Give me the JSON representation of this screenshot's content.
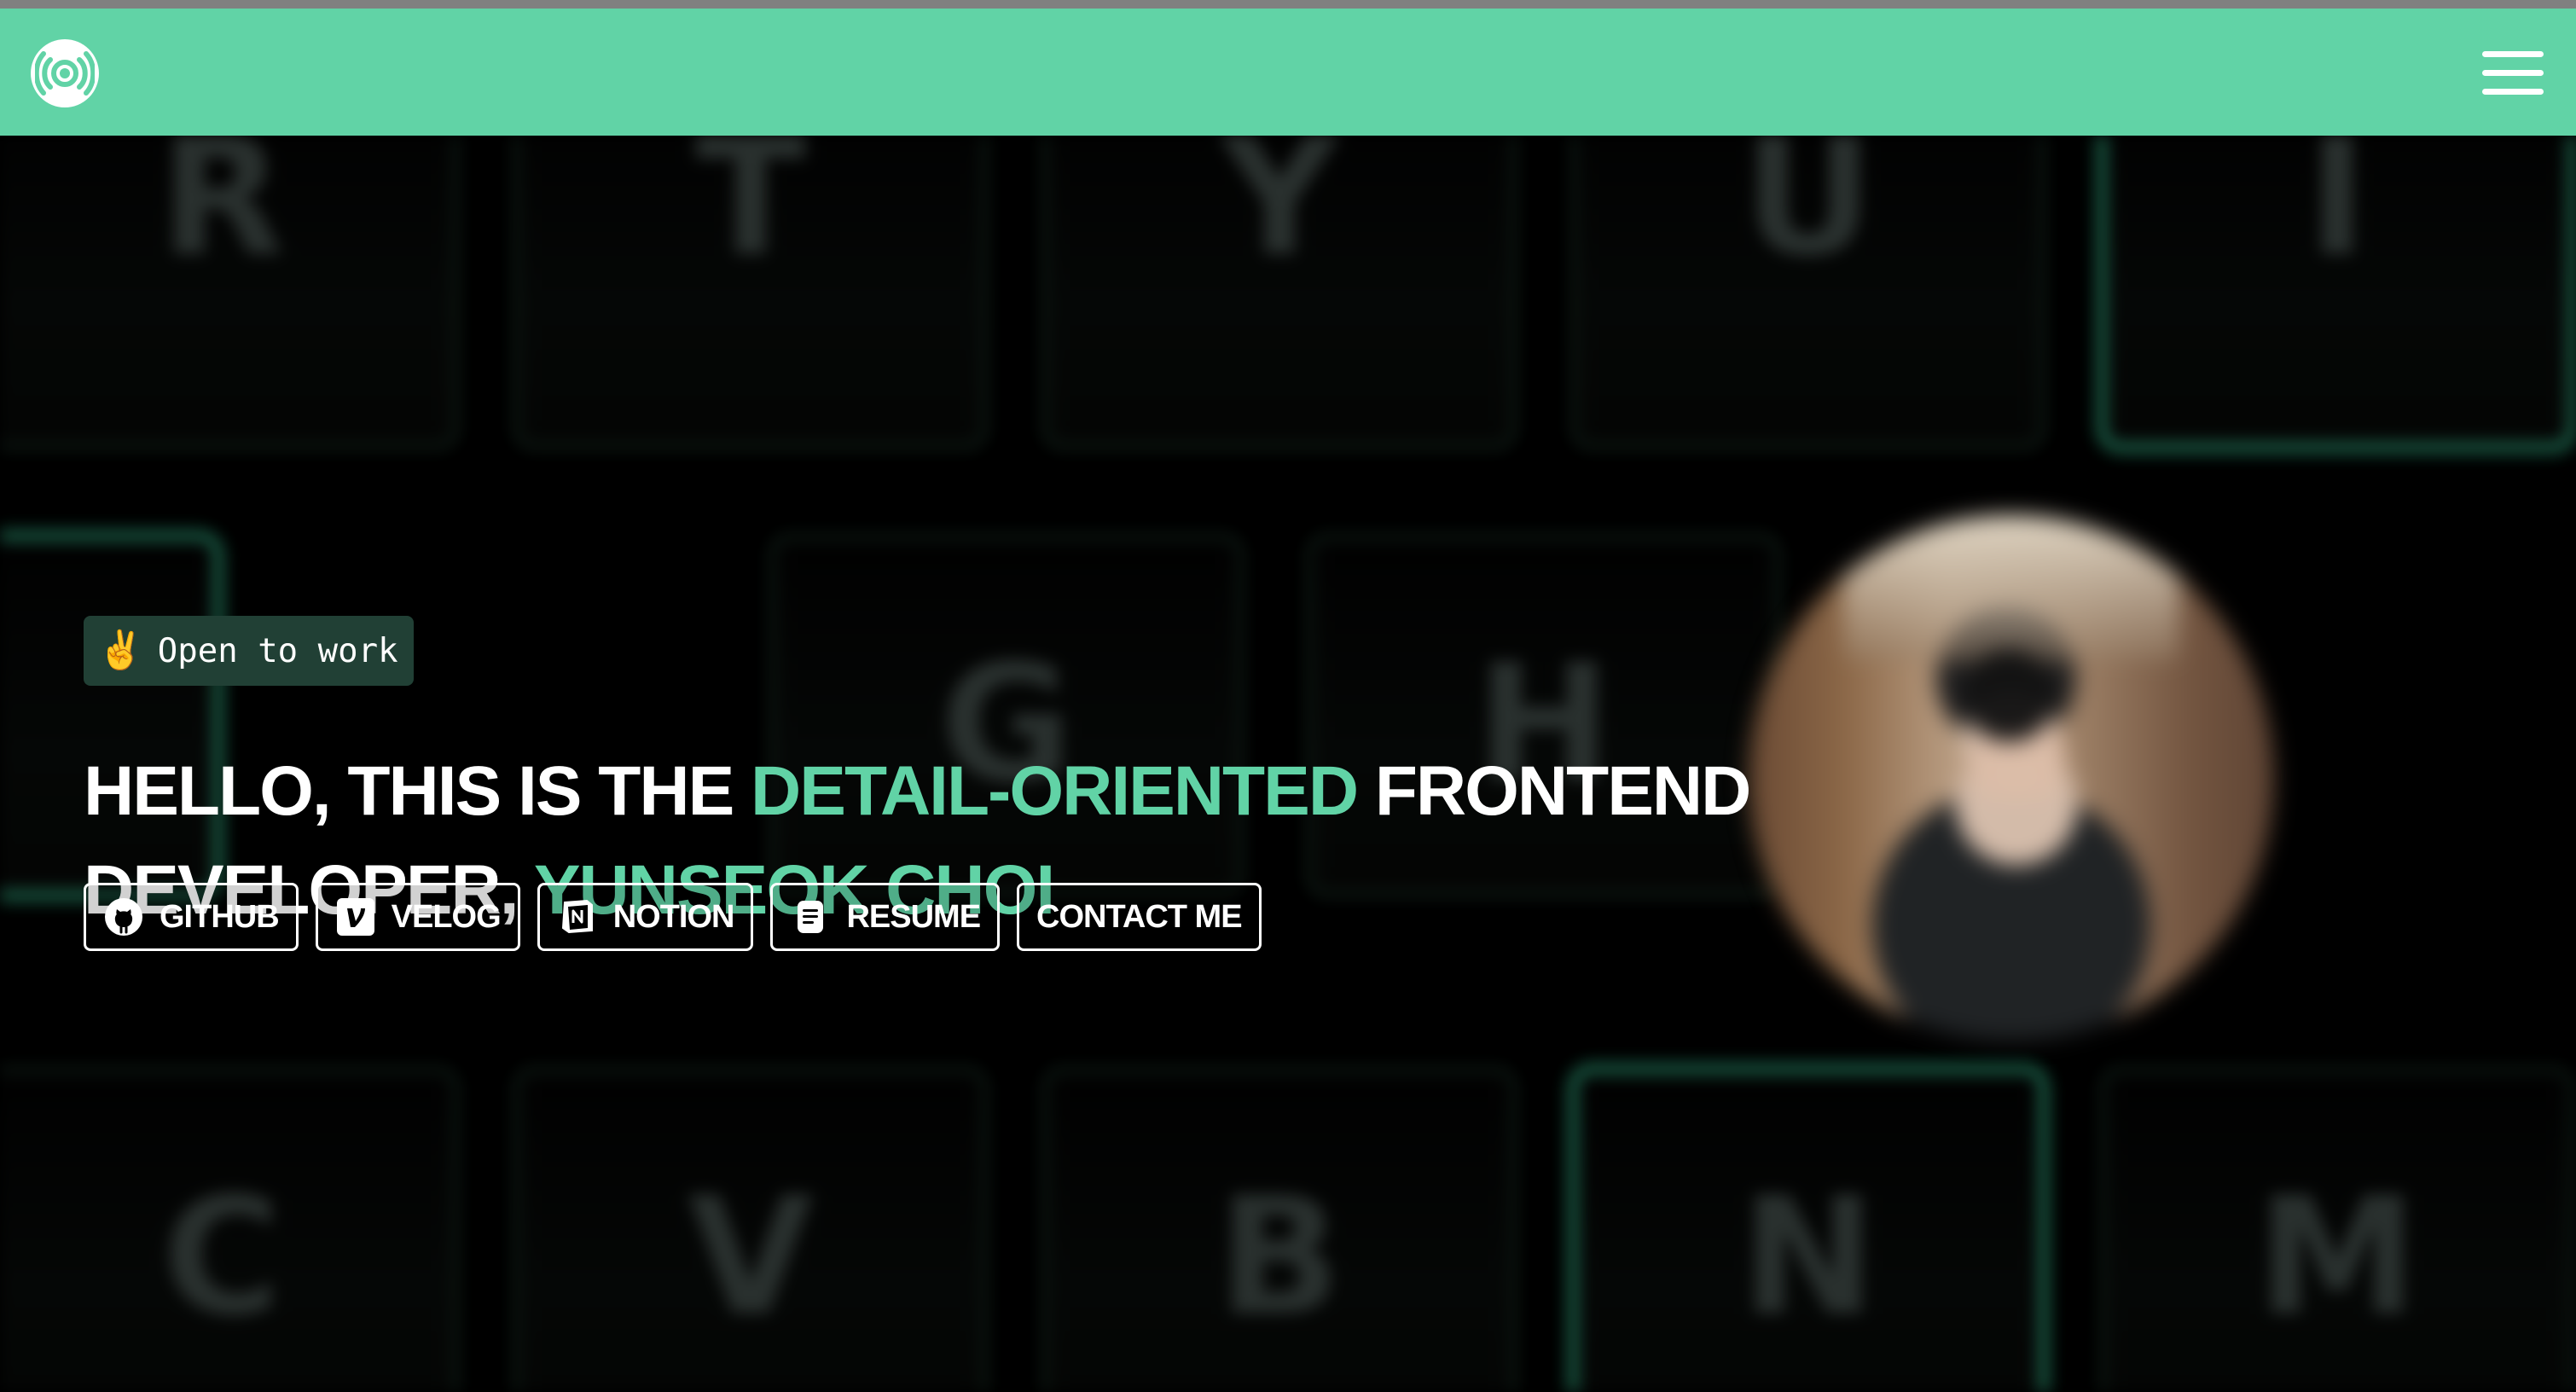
{
  "nav": {
    "logo": {
      "icon": "broadcast-icon"
    },
    "menu": {
      "icon": "hamburger-menu-icon"
    },
    "colors": {
      "accent": "#61d3a6",
      "surface": "#000000",
      "text": "#ffffff"
    }
  },
  "background": {
    "keyboard_keys": [
      "R",
      "T",
      "Y",
      "U",
      "I",
      "G",
      "H",
      "C",
      "V",
      "B",
      "N",
      "M"
    ]
  },
  "hero": {
    "badge": {
      "emoji": "✌️",
      "text": "Open to work"
    },
    "headline": {
      "line1_before": "HELLO, THIS IS THE ",
      "line1_highlight": "DETAIL-ORIENTED",
      "line1_after": " FRONTEND",
      "line2_before": "DEVELOPER, ",
      "line2_highlight": "YUNSEOK CHOI"
    },
    "links": [
      {
        "label": "GITHUB",
        "icon": "github-icon"
      },
      {
        "label": "VELOG",
        "icon": "velog-icon"
      },
      {
        "label": "NOTION",
        "icon": "notion-icon"
      },
      {
        "label": "RESUME",
        "icon": "document-icon"
      },
      {
        "label": "CONTACT ME",
        "icon": ""
      }
    ]
  }
}
